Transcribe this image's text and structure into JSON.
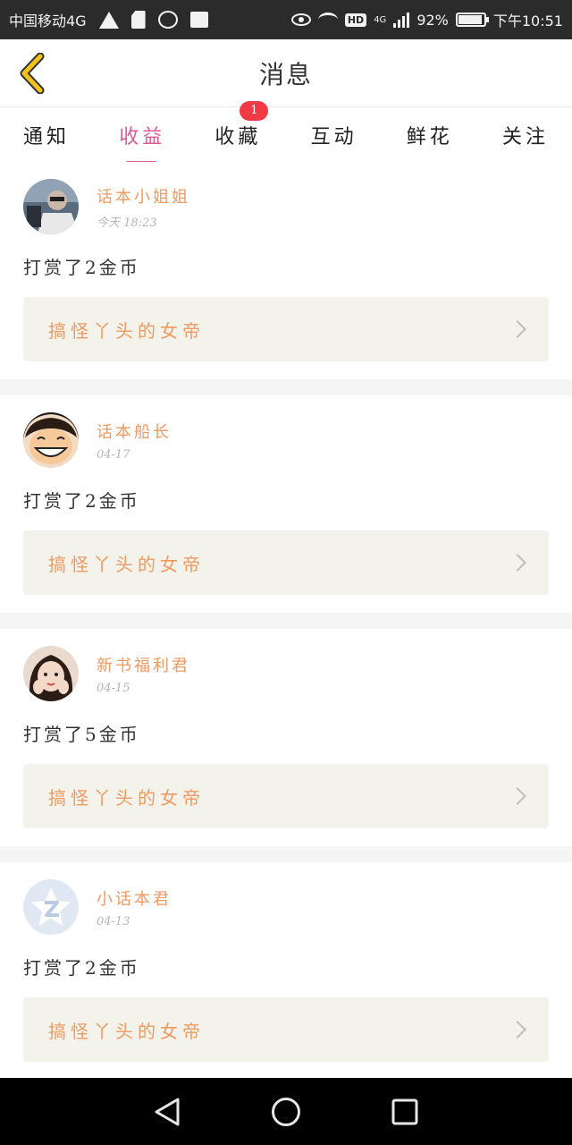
{
  "status_bar": {
    "carrier": "中国移动4G",
    "battery": "92%",
    "network": "4G",
    "hd": "HD",
    "time": "下午10:51"
  },
  "header": {
    "title": "消息",
    "back_icon": "chevron-left-icon",
    "back_color": "#f0c21a"
  },
  "tabs": [
    {
      "label": "通知",
      "active": false
    },
    {
      "label": "收益",
      "active": true
    },
    {
      "label": "收藏",
      "active": false,
      "badge": "1"
    },
    {
      "label": "互动",
      "active": false
    },
    {
      "label": "鲜花",
      "active": false
    },
    {
      "label": "关注",
      "active": false
    }
  ],
  "colors": {
    "accent": "#e05a97",
    "sender": "#ef9a62",
    "badge": "#f03a44",
    "book_bg": "#f3f3ec"
  },
  "messages": [
    {
      "sender": "话本小姐姐",
      "time": "今天 18:23",
      "text": "打赏了2金币",
      "book": "搞怪丫头的女帝",
      "avatar": "avatar-photo-man-car"
    },
    {
      "sender": "话本船长",
      "time": "04-17",
      "text": "打赏了2金币",
      "book": "搞怪丫头的女帝",
      "avatar": "avatar-cartoon-luffy"
    },
    {
      "sender": "新书福利君",
      "time": "04-15",
      "text": "打赏了5金币",
      "book": "搞怪丫头的女帝",
      "avatar": "avatar-photo-girl"
    },
    {
      "sender": "小话本君",
      "time": "04-13",
      "text": "打赏了2金币",
      "book": "搞怪丫头的女帝",
      "avatar": "avatar-default-star"
    }
  ]
}
